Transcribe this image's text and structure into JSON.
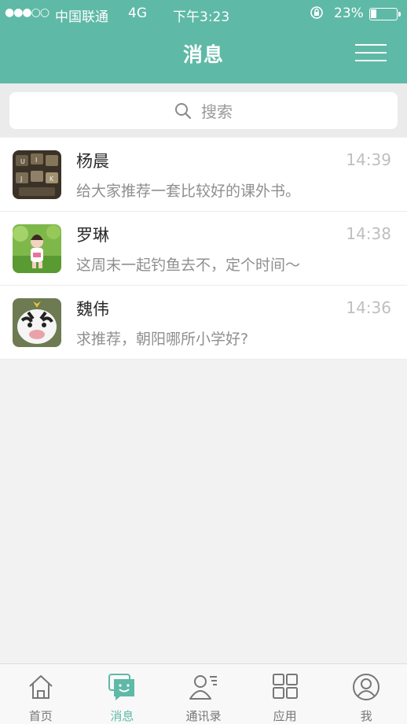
{
  "status_bar": {
    "signal": "●●●○○",
    "carrier": "中国联通",
    "network": "4G",
    "time": "下午3:23",
    "battery_percent_text": "23%",
    "battery_level": 0.23
  },
  "header": {
    "title": "消息",
    "menu_icon": "hamburger-icon"
  },
  "search": {
    "placeholder": "搜索",
    "icon": "search-icon"
  },
  "conversations": [
    {
      "name": "杨晨",
      "preview": "给大家推荐一套比较好的课外书。",
      "time": "14:39",
      "avatar": "keyboard-photo"
    },
    {
      "name": "罗琳",
      "preview": "这周末一起钓鱼去不，定个时间～",
      "time": "14:38",
      "avatar": "child-on-grass-photo"
    },
    {
      "name": "魏伟",
      "preview": "求推荐，朝阳哪所小学好?",
      "time": "14:36",
      "avatar": "cartoon-zebra-photo"
    }
  ],
  "tabs": [
    {
      "label": "首页",
      "icon": "home-icon",
      "active": false
    },
    {
      "label": "消息",
      "icon": "chat-icon",
      "active": true
    },
    {
      "label": "通讯录",
      "icon": "contacts-icon",
      "active": false
    },
    {
      "label": "应用",
      "icon": "apps-grid-icon",
      "active": false
    },
    {
      "label": "我",
      "icon": "profile-icon",
      "active": false
    }
  ],
  "colors": {
    "accent": "#5fb9a7",
    "background": "#f2f2f2",
    "inactive_tab": "#777777",
    "time_gray": "#bfbfbf"
  }
}
